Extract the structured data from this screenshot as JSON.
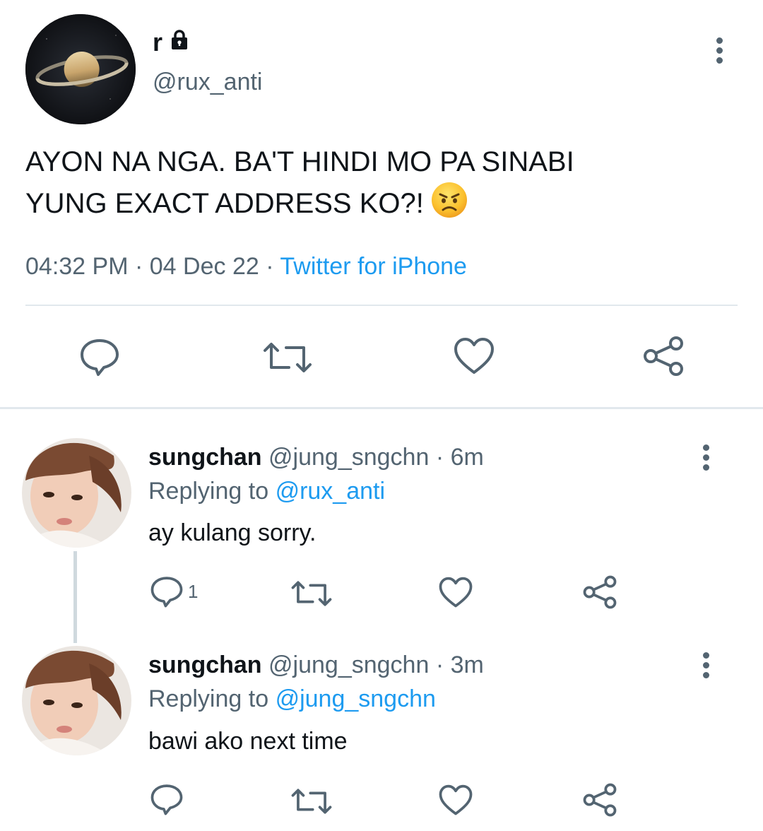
{
  "main_tweet": {
    "author_name": "r",
    "handle": "@rux_anti",
    "text_line1": "AYON NA NGA. BA'T HINDI MO PA SINABI",
    "text_line2": "YUNG EXACT ADDRESS KO?!",
    "emoji": "angry-face",
    "time": "04:32 PM",
    "separator": "·",
    "date": "04 Dec 22",
    "source": "Twitter for iPhone",
    "actions": [
      "reply-icon",
      "retweet-icon",
      "like-icon",
      "share-icon"
    ]
  },
  "replies": [
    {
      "name": "sungchan",
      "handle": "@jung_sngchn",
      "separator": "·",
      "age": "6m",
      "replying_label": "Replying to",
      "replying_to": "@rux_anti",
      "text": "ay kulang sorry.",
      "reply_count": "1"
    },
    {
      "name": "sungchan",
      "handle": "@jung_sngchn",
      "separator": "·",
      "age": "3m",
      "replying_label": "Replying to",
      "replying_to": "@jung_sngchn",
      "text": "bawi ako next time",
      "reply_count": ""
    }
  ],
  "colors": {
    "text": "#0f1419",
    "secondary": "#536471",
    "accent": "#1d9bf0",
    "divider": "#e1e8ed"
  }
}
